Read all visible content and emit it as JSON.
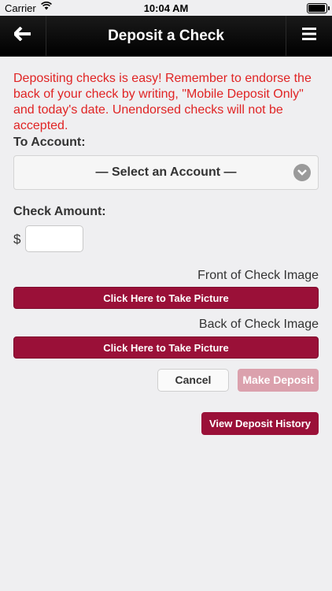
{
  "status_bar": {
    "carrier": "Carrier",
    "time": "10:04 AM",
    "battery_level": 0.95
  },
  "navbar": {
    "title": "Deposit a Check",
    "back_icon": "back-arrow-icon",
    "menu_icon": "hamburger-menu-icon"
  },
  "intro_text": "Depositing checks is easy! Remember to endorse the back of your check by writing, \"Mobile Deposit Only\" and today's date. Unendorsed checks will not be accepted.",
  "to_account": {
    "label": "To Account:",
    "select_value": "— Select an Account —"
  },
  "check_amount": {
    "label": "Check Amount:",
    "currency_symbol": "$",
    "value": ""
  },
  "front_image": {
    "label": "Front of Check Image",
    "button": "Click Here to Take Picture"
  },
  "back_image": {
    "label": "Back of Check Image",
    "button": "Click Here to Take Picture"
  },
  "actions": {
    "cancel": "Cancel",
    "make_deposit": "Make Deposit",
    "view_history": "View Deposit History"
  },
  "colors": {
    "accent": "#9a1038",
    "accent_disabled": "#dba1ad",
    "intro_text": "#e02424"
  }
}
